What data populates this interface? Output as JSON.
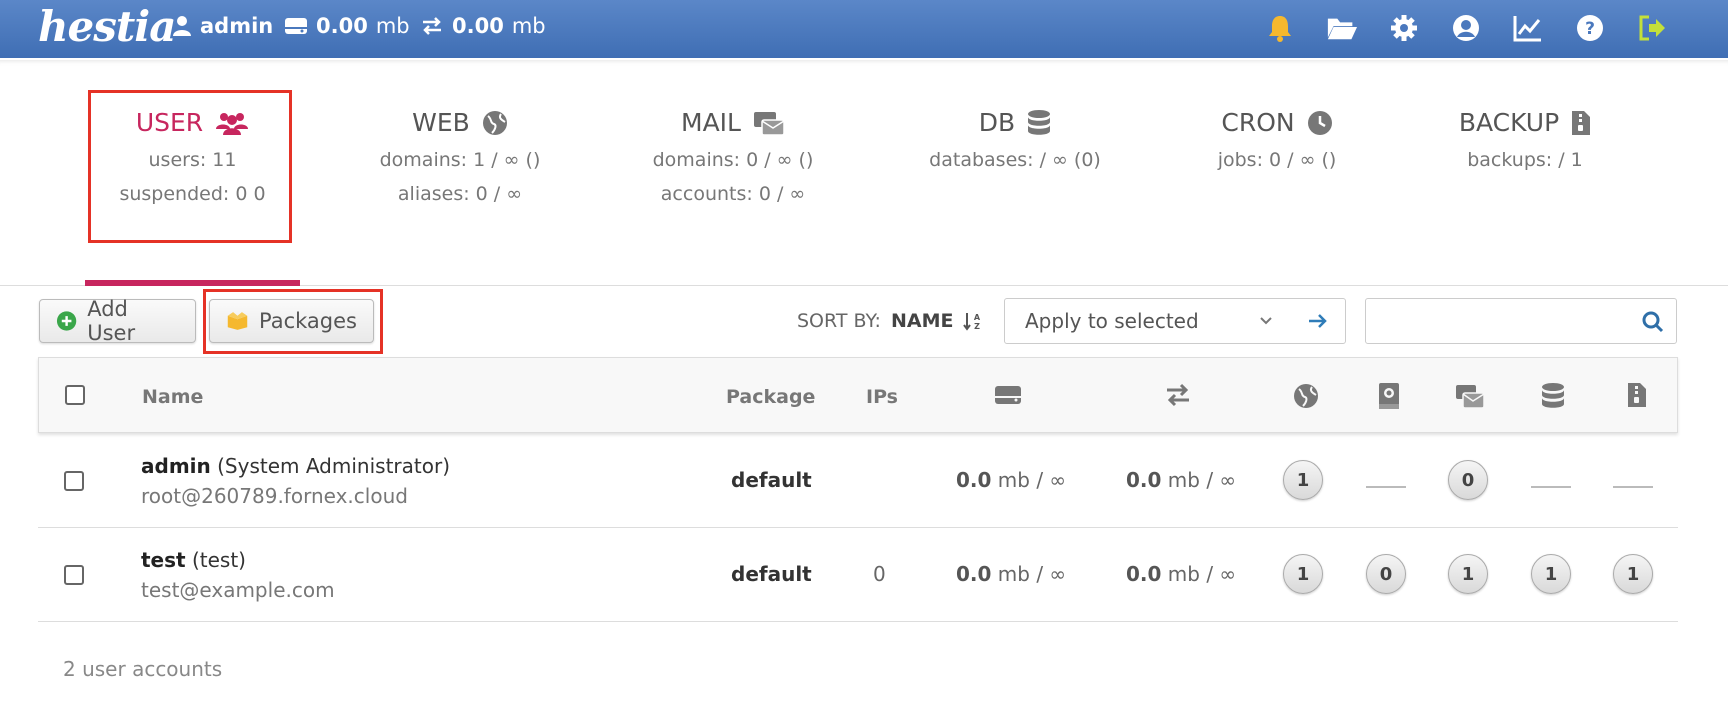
{
  "header": {
    "logo": "hestia",
    "user": "admin",
    "disk_value": "0.00",
    "disk_unit": "mb",
    "bandwidth_value": "0.00",
    "bandwidth_unit": "mb"
  },
  "tabs": [
    {
      "title": "USER",
      "line1": "users: 11",
      "line2": "suspended: 0 0"
    },
    {
      "title": "WEB",
      "line1": "domains: 1 / ∞ ()",
      "line2": "aliases: 0 / ∞"
    },
    {
      "title": "MAIL",
      "line1": "domains: 0 / ∞ ()",
      "line2": "accounts: 0 / ∞"
    },
    {
      "title": "DB",
      "line1": "databases: / ∞ (0)",
      "line2": ""
    },
    {
      "title": "CRON",
      "line1": "jobs: 0 / ∞ ()",
      "line2": ""
    },
    {
      "title": "BACKUP",
      "line1": "backups: / 1",
      "line2": ""
    }
  ],
  "toolbar": {
    "add_user": "Add User",
    "packages": "Packages",
    "sort_label": "SORT BY:",
    "sort_value": "NAME",
    "apply_selected": "Apply to selected",
    "search_placeholder": ""
  },
  "table": {
    "headers": {
      "name": "Name",
      "package": "Package",
      "ips": "IPs"
    },
    "rows": [
      {
        "username": "admin",
        "fullname": "(System Administrator)",
        "email": "root@260789.fornex.cloud",
        "package": "default",
        "ips": "",
        "disk_value": "0.0",
        "disk_suffix": "mb / ∞",
        "bw_value": "0.0",
        "bw_suffix": "mb / ∞",
        "web": "1",
        "dns": "",
        "mail": "0",
        "db": "",
        "backup": ""
      },
      {
        "username": "test",
        "fullname": "(test)",
        "email": "test@example.com",
        "package": "default",
        "ips": "0",
        "disk_value": "0.0",
        "disk_suffix": "mb / ∞",
        "bw_value": "0.0",
        "bw_suffix": "mb / ∞",
        "web": "1",
        "dns": "0",
        "mail": "1",
        "db": "1",
        "backup": "1"
      }
    ]
  },
  "footer": {
    "count": "2 user accounts"
  },
  "colors": {
    "accent": "#c7265e",
    "header": "#4a78bd",
    "highlight": "#e53226"
  }
}
